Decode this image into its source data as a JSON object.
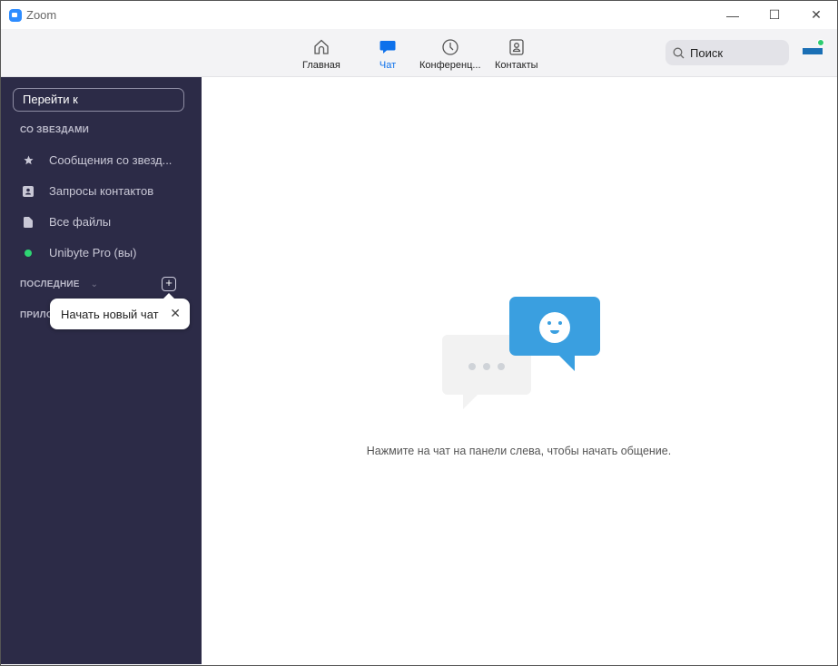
{
  "window": {
    "title": "Zoom",
    "controls": [
      "minimize",
      "maximize",
      "close"
    ]
  },
  "toolbar": {
    "tabs": [
      {
        "label": "Главная",
        "icon": "home-icon"
      },
      {
        "label": "Чат",
        "icon": "chat-icon",
        "active": true
      },
      {
        "label": "Конференц...",
        "icon": "clock-icon"
      },
      {
        "label": "Контакты",
        "icon": "contacts-icon"
      }
    ],
    "search_placeholder": "Поиск",
    "accent": "#0e71eb"
  },
  "sidebar": {
    "goto_placeholder": "Перейти к",
    "starred_header": "СО ЗВЕЗДАМИ",
    "items": [
      {
        "label": "Сообщения со звезд...",
        "icon": "star-icon"
      },
      {
        "label": "Запросы контактов",
        "icon": "contact-card-icon"
      },
      {
        "label": "Все файлы",
        "icon": "file-icon"
      },
      {
        "label": "Unibyte Pro (вы)",
        "icon": "online-dot-icon"
      }
    ],
    "recent_header": "ПОСЛЕДНИЕ",
    "apps_header": "ПРИЛО",
    "tooltip": "Начать новый чат"
  },
  "main": {
    "hint": "Нажмите на чат на панели слева, чтобы начать общение."
  }
}
